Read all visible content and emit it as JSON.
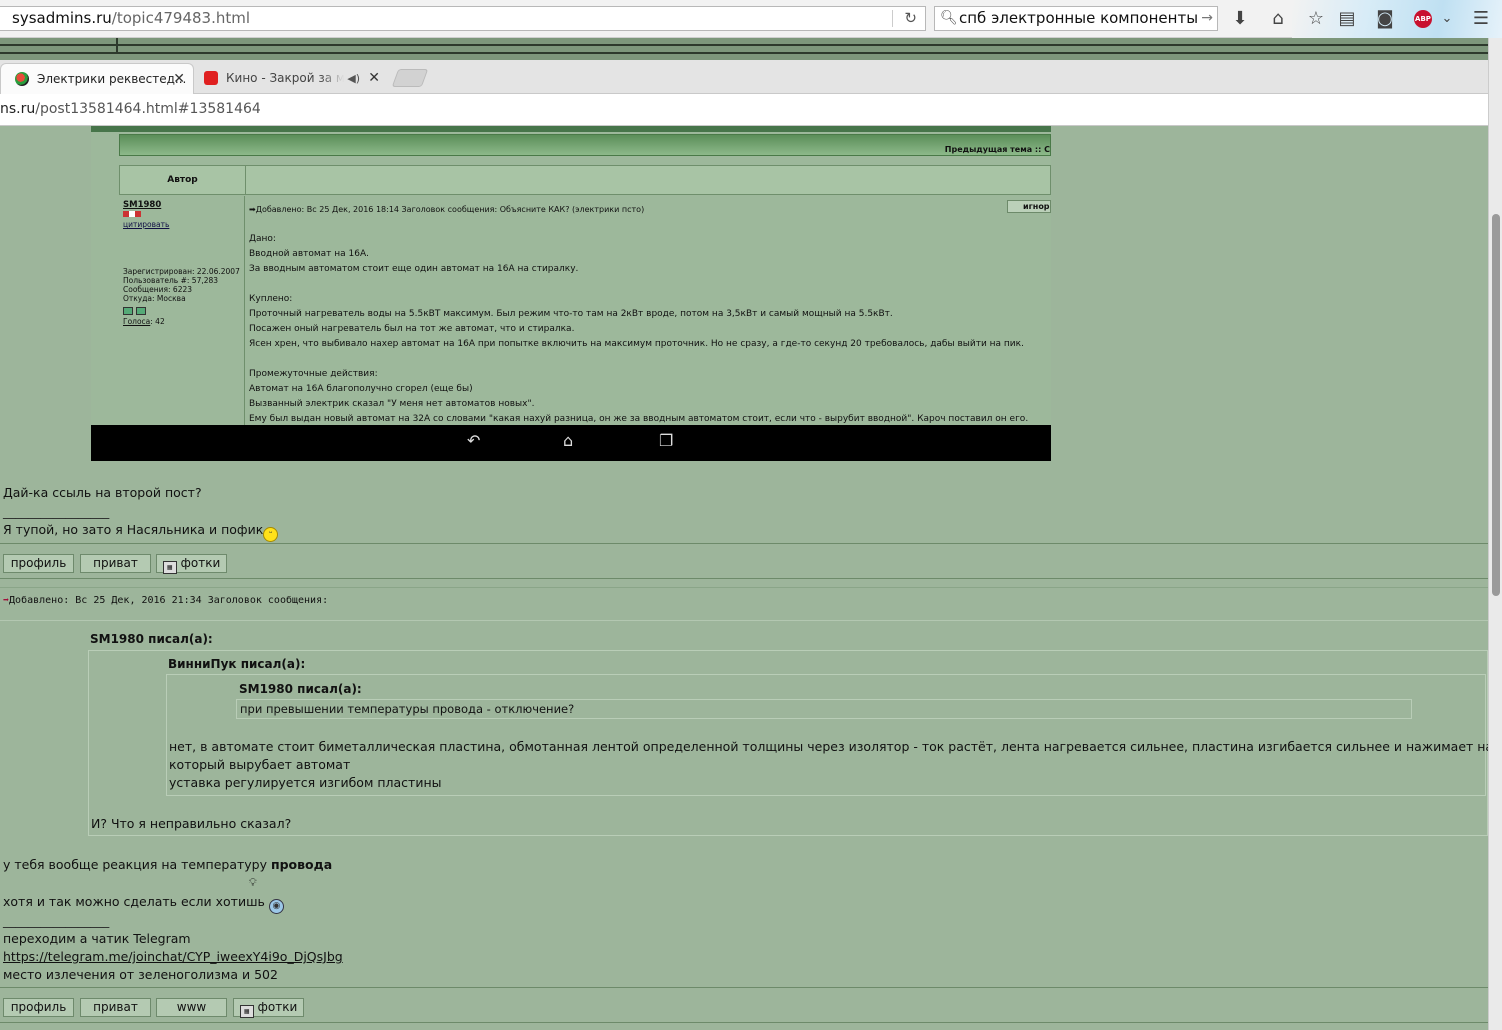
{
  "outer_browser": {
    "url_host": "sysadmins.ru",
    "url_path": "/topic479483.html",
    "search_text": "спб электронные компоненты",
    "icons": [
      "reload-icon",
      "search-icon",
      "download-icon",
      "home-icon",
      "bookmark-star-icon",
      "reading-list-icon",
      "pocket-icon",
      "adblock-plus-icon",
      "menu-icon"
    ],
    "abp_label": "ABP"
  },
  "inner_browser": {
    "tabs": [
      {
        "label": "Электрики реквестед...",
        "active": true
      },
      {
        "label": "Кино - Закрой за мной",
        "active": false
      }
    ],
    "url_host": "ns.ru",
    "url_path": "/post13581464.html#13581464"
  },
  "screenshot_post": {
    "prev_topic": "Предыдущая тема :: С",
    "author_header": "Автор",
    "nick": "SM1980",
    "cite": "цитировать",
    "registered": "Зарегистрирован: 22.06.2007",
    "user_no": "Пользователь #: 57,283",
    "messages": "Сообщения: 6223",
    "from": "Откуда: Москва",
    "votes_label": "Голоса",
    "votes_value": ": 42",
    "meta": "Добавлено: Вс 25 Дек, 2016 18:14    Заголовок сообщения: Объясните КАК? (электрики псто)",
    "ignore": "игнор",
    "body": "Дано:\nВводной автомат на 16А.\nЗа вводным автоматом стоит еще один автомат на 16А на стиралку.\n\nКуплено:\nПроточный нагреватель воды на 5.5кВТ максимум. Был режим что-то там на 2кВт вроде, потом на 3,5кВт и самый мощный на 5.5кВт.\nПосажен оный нагреватель был на тот же автомат, что и стиралка.\nЯсен хрен, что выбивало нахер автомат на 16А при попытке включить на максимум проточник. Но не сразу, а где-то секунд 20 требовалось, дабы выйти на пик.\n\nПромежуточные действия:\nАвтомат на 16А благополучно сгорел (еще бы)\nВызванный электрик сказал \"У меня нет автоматов новых\".\nЕму был выдан новый автомат на 32А со словами \"какая нахуй разница, он же за вводным автоматом стоит, если что - вырубит вводной\". Кароч поставил он его."
  },
  "post1": {
    "text": "Дай-ка ссыль на второй пост?",
    "sig_line": "_________________",
    "sig": "Я тупой, но зато я Насяльника и пофик",
    "buttons": {
      "profile": "профиль",
      "private": "приват",
      "photos": "фотки"
    }
  },
  "post2": {
    "meta": "Добавлено: Вс 25 Дек, 2016 21:34    Заголовок сообщения:",
    "q1_author": "SM1980 писал(а):",
    "q2_author": "ВинниПук писал(а):",
    "q3_author": "SM1980 писал(а):",
    "q3_text": "при превышении температуры провода - отключение?",
    "q2_text_1": "нет, в автомате стоит биметаллическая пластина, обмотанная лентой определенной толщины через изолятор - ток растёт, лента нагревается сильнее, пластина изгибается сильнее и нажимает на толкатель,",
    "q2_text_2": "который вырубает автомат",
    "q2_text_3": "уставка регулируется изгибом пластины",
    "q1_text": "И? Что я неправильно сказал?",
    "reply_1a": "у тебя вообще реакция на температуру ",
    "reply_1b": "провода",
    "reply_2": "хотя и так можно сделать если хотишь",
    "sig_line": "_________________",
    "sig_1": "переходим а чатик Telegram",
    "sig_link": "https://telegram.me/joinchat/CYP_iweexY4i9o_DjQsJbg",
    "sig_3": "место излечения от зеленоголизма и 502",
    "buttons": {
      "profile": "профиль",
      "private": "приват",
      "www": "www",
      "photos": "фотки"
    }
  }
}
